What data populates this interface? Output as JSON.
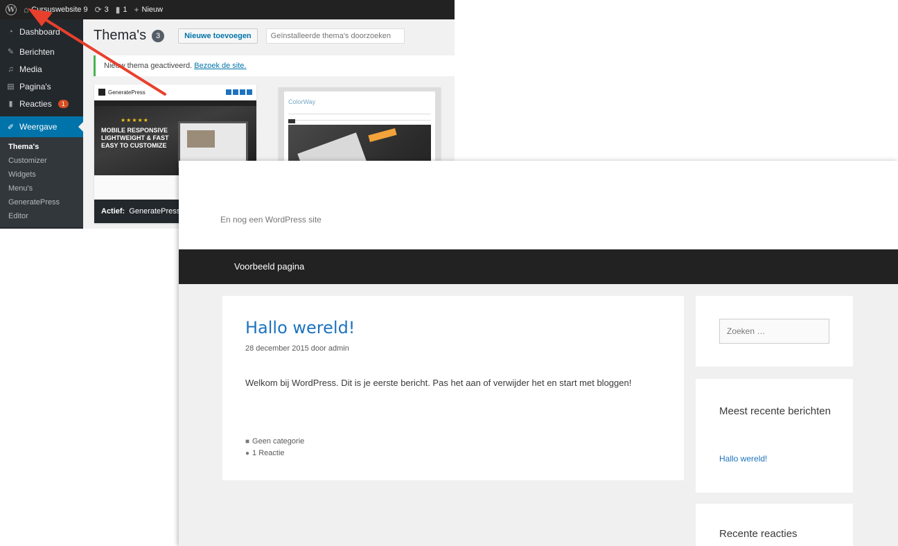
{
  "colors": {
    "wp_admin_bar": "#222222",
    "wp_menu": "#23282d",
    "wp_accent": "#0073aa",
    "annotation_arrow": "#e8402d",
    "site_nav": "#222222",
    "link": "#1e73be"
  },
  "admin_bar": {
    "site_name": "Cursuswebsite 9",
    "updates_count": "3",
    "comments_count": "1",
    "new_label": "Nieuw"
  },
  "admin_menu": {
    "items": [
      {
        "label": "Dashboard",
        "icon": "dashboard-icon"
      },
      {
        "label": "Berichten",
        "icon": "pin-icon"
      },
      {
        "label": "Media",
        "icon": "media-icon"
      },
      {
        "label": "Pagina's",
        "icon": "page-icon"
      },
      {
        "label": "Reacties",
        "icon": "comment-icon",
        "badge": "1"
      }
    ],
    "active": {
      "label": "Weergave",
      "icon": "appearance-icon"
    },
    "submenu": [
      "Thema's",
      "Customizer",
      "Widgets",
      "Menu's",
      "GeneratePress",
      "Editor"
    ]
  },
  "themes_page": {
    "title": "Thema's",
    "count": "3",
    "add_new_label": "Nieuwe toevoegen",
    "search_placeholder": "Geïnstalleerde thema's doorzoeken",
    "notice_text": "Nieuw thema geactiveerd.",
    "notice_link": "Bezoek de site.",
    "active_theme": {
      "name": "GeneratePress",
      "active_prefix": "Actief:",
      "hero_stars": "★★★★★",
      "hero_line1": "MOBILE RESPONSIVE",
      "hero_line2": "LIGHTWEIGHT & FAST",
      "hero_line3": "EASY TO CUSTOMIZE",
      "logo_text": "GeneratePress"
    },
    "other_theme": {
      "name": "ColorWay"
    }
  },
  "site": {
    "tagline": "En nog een WordPress site",
    "nav": [
      "Voorbeeld pagina"
    ],
    "post": {
      "title": "Hallo wereld!",
      "meta": "28 december 2015 door admin",
      "content": "Welkom bij WordPress. Dit is je eerste bericht. Pas het aan of verwijder het en start met bloggen!",
      "category": "Geen categorie",
      "comments": "1 Reactie"
    },
    "sidebar": {
      "search_placeholder": "Zoeken …",
      "recent_posts_title": "Meest recente berichten",
      "recent_posts": [
        "Hallo wereld!"
      ],
      "recent_comments_title": "Recente reacties"
    }
  }
}
